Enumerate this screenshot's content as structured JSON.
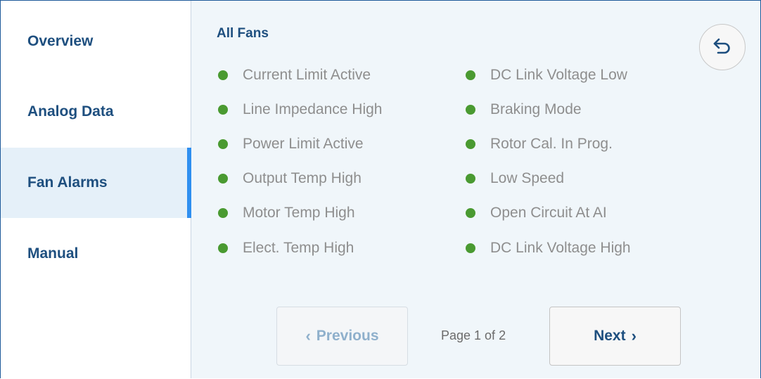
{
  "sidebar": {
    "items": [
      {
        "label": "Overview"
      },
      {
        "label": "Analog Data"
      },
      {
        "label": "Fan Alarms",
        "active": true
      },
      {
        "label": "Manual"
      }
    ]
  },
  "main": {
    "title": "All Fans",
    "back_icon": "undo-arrow-icon",
    "alarms_left": [
      "Current Limit Active",
      "Line Impedance High",
      "Power Limit Active",
      "Output Temp High",
      "Motor Temp High",
      "Elect. Temp High"
    ],
    "alarms_right": [
      "DC Link Voltage Low",
      "Braking Mode",
      "Rotor Cal. In Prog.",
      "Low Speed",
      "Open Circuit At AI",
      "DC Link Voltage High"
    ],
    "pagination": {
      "prev_label": "Previous",
      "next_label": "Next",
      "page_indicator": "Page 1 of 2"
    }
  },
  "colors": {
    "accent": "#2f8ff0",
    "heading": "#1e4f7f",
    "status_ok": "#4a9a31"
  }
}
